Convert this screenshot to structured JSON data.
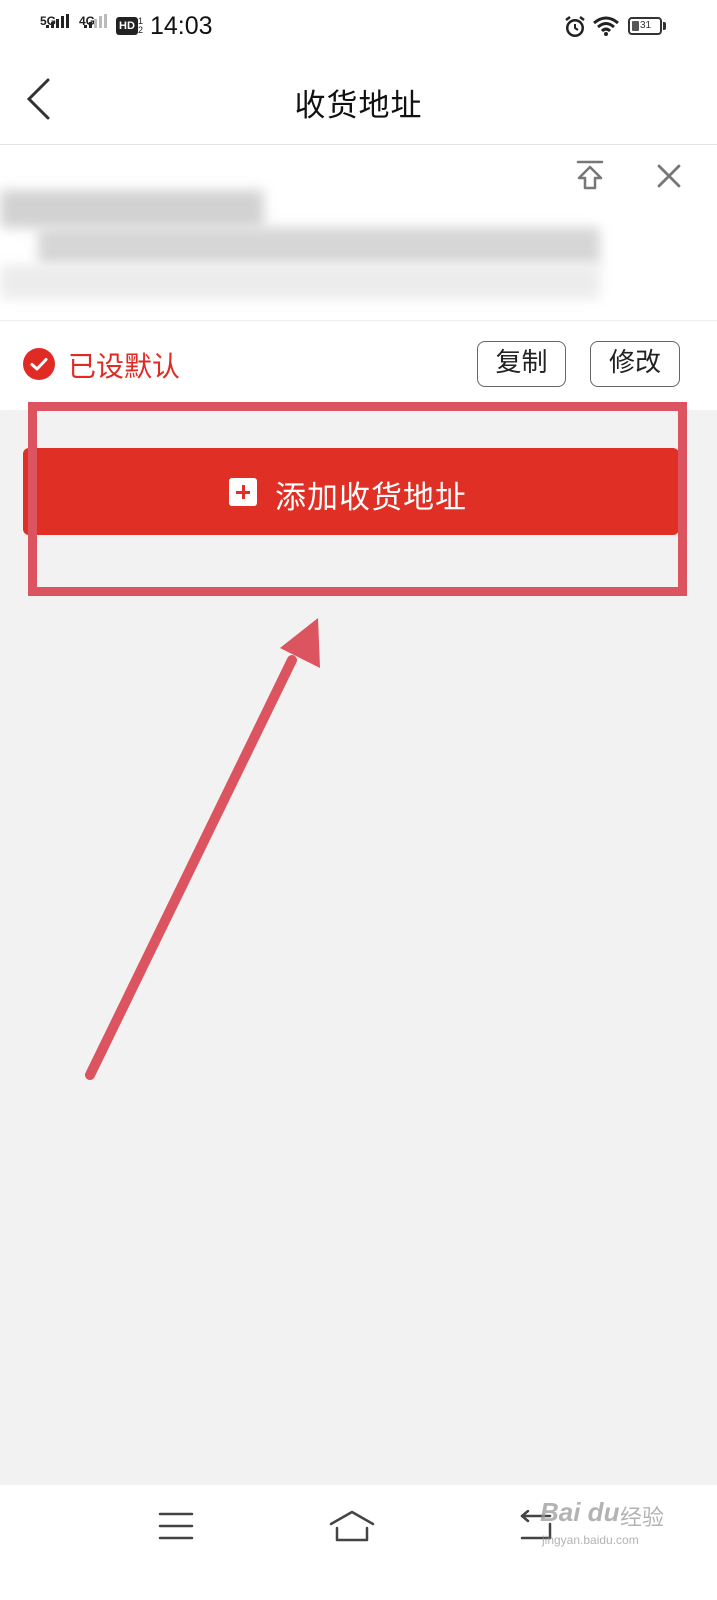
{
  "status_bar": {
    "net1": "5G",
    "net2": "4G",
    "hd_badge": "HD",
    "hd_sub": "1 2",
    "time": "14:03",
    "battery": "31",
    "icons": [
      "signal-5g-icon",
      "signal-4g-icon",
      "hd-voice-icon",
      "alarm-icon",
      "wifi-icon",
      "battery-icon"
    ]
  },
  "nav": {
    "title": "收货地址",
    "back_icon": "chevron-left-icon"
  },
  "address_card": {
    "top_icon": "pin-to-top-icon",
    "close_icon": "close-icon",
    "default_label": "已设默认",
    "copy_label": "复制",
    "edit_label": "修改"
  },
  "add_button": {
    "label": "添加收货地址",
    "icon": "plus-square-icon"
  },
  "bottom_nav": {
    "icons": [
      "menu-icon",
      "home-icon",
      "back-icon"
    ]
  },
  "watermark": {
    "logo": "Bai du",
    "cn": "经验",
    "url": "jingyan.baidu.com"
  },
  "colors": {
    "accent": "#e02f25",
    "annotation": "#db5460",
    "background": "#f2f2f2"
  }
}
